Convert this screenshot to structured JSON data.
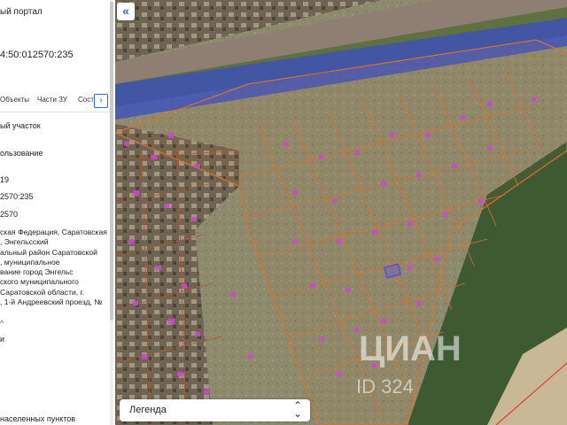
{
  "panel": {
    "title_fragment": "ый портал",
    "cadastral_fragment": "4:50:012570:235",
    "tabs": [
      "Объекты",
      "Части ЗУ",
      "Соста"
    ],
    "tab_scroll_icon": "chevron-right-icon",
    "rows": [
      "ый участок",
      "ользование",
      "19",
      "2570:235",
      "2570"
    ],
    "address": "ская Федерация, Саратовская\n, Энгельсский\nальный район Саратовской\n, муниципальное\nвание город Энгельс\nского муниципального\nСаратовской области, г.\n, 1-й Андреевский проезд, №",
    "expand_icon": "chevron-up-icon",
    "bottom_rows": [
      "и",
      "населенных пунктов"
    ]
  },
  "map": {
    "collapse_icon": "double-chevron-left-icon",
    "legend_label": "Легенда",
    "legend_icon": "up-down-arrows-icon",
    "watermark": "ЦИАН",
    "watermark_id": "ID 324"
  },
  "colors": {
    "parcel_outline": "#d9722e",
    "river_overlay": "#3a4fc0",
    "building_marker": "#d046d6",
    "selected_parcel": "#5a4de0",
    "accent": "#2b6bd6"
  }
}
